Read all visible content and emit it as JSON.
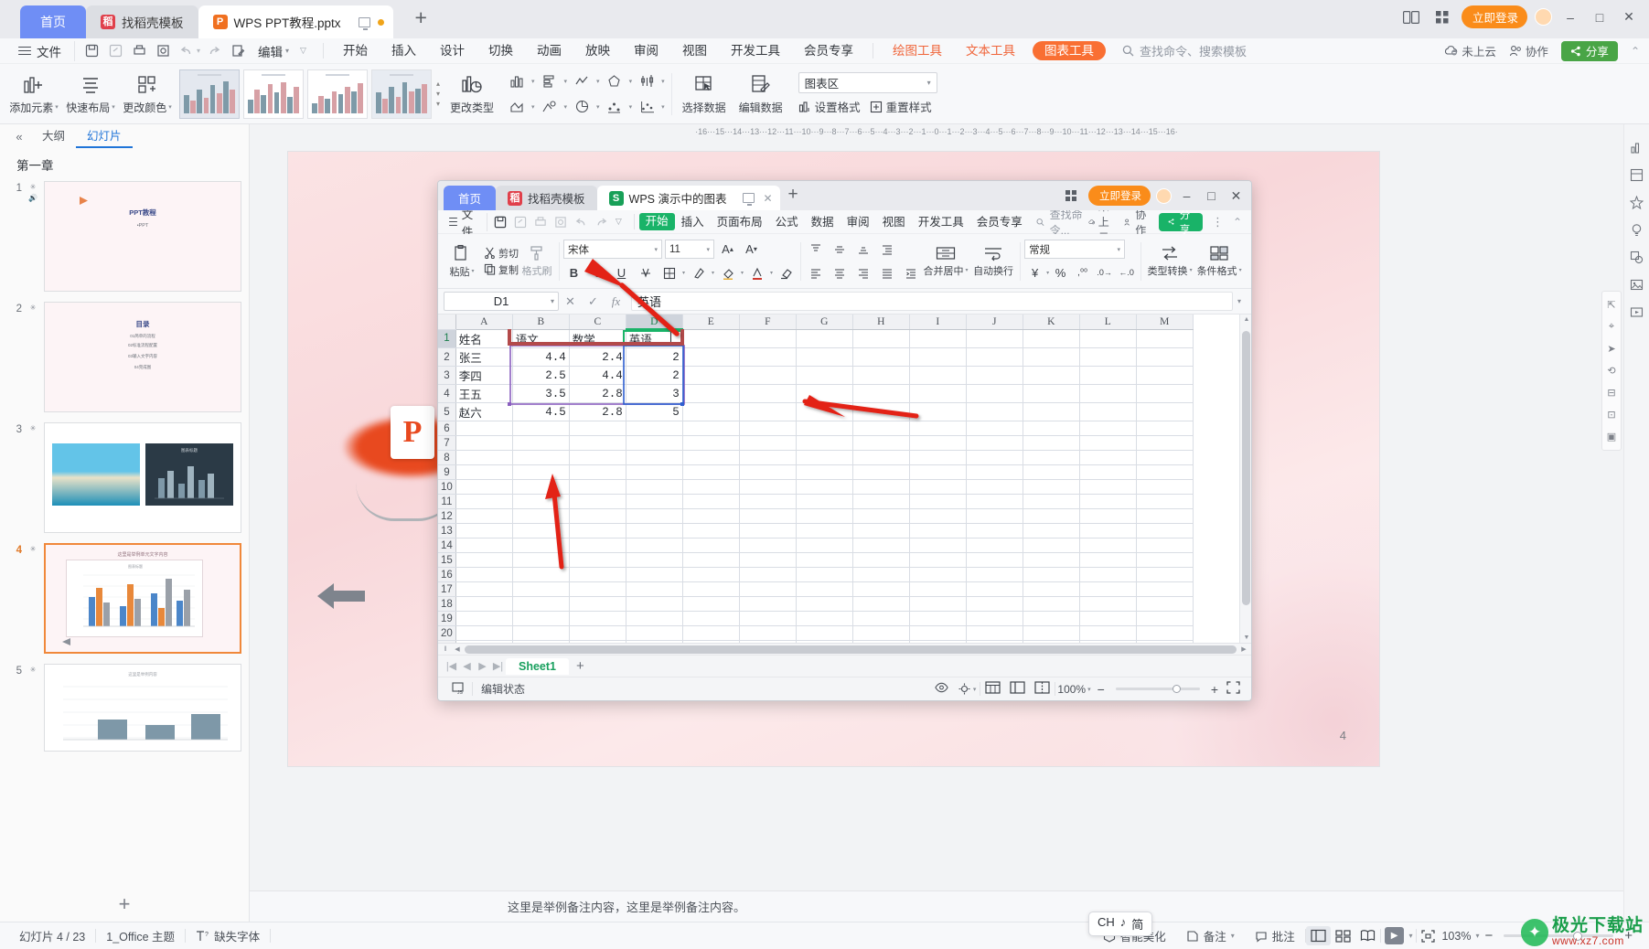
{
  "app": {
    "tabs": [
      {
        "label": "首页",
        "kind": "home"
      },
      {
        "label": "找稻壳模板",
        "kind": "tpl",
        "icon": "daoke-icon"
      },
      {
        "label": "WPS PPT教程.pptx",
        "kind": "doc",
        "icon": "ppt-file-icon"
      }
    ],
    "new_tab": "+",
    "login_label": "立即登录",
    "window_buttons": [
      "minimize",
      "maximize",
      "close"
    ]
  },
  "menubar": {
    "file_label": "文件",
    "quick_access": [
      "save-icon",
      "save-as-icon",
      "print-icon",
      "print-preview-icon",
      "undo-icon",
      "redo-icon",
      "edit-mode-icon"
    ],
    "edit_label": "编辑",
    "items": [
      "开始",
      "插入",
      "设计",
      "切换",
      "动画",
      "放映",
      "审阅",
      "视图",
      "开发工具",
      "会员专享"
    ],
    "context_items": [
      "绘图工具",
      "文本工具"
    ],
    "active_pill": "图表工具",
    "search_placeholder": "查找命令、搜索模板",
    "cloud_label": "未上云",
    "collab_label": "协作",
    "share_label": "分享"
  },
  "ribbon": {
    "buttons": [
      {
        "label": "添加元素",
        "icon": "add-element-icon",
        "dropdown": true
      },
      {
        "label": "快速布局",
        "icon": "quick-layout-icon",
        "dropdown": true
      },
      {
        "label": "更改颜色",
        "icon": "change-color-icon",
        "dropdown": true
      }
    ],
    "gallery_count": 4,
    "gallery_selected_index": 0,
    "change_type_label": "更改类型",
    "select_data_label": "选择数据",
    "edit_data_label": "编辑数据",
    "chart_area_value": "图表区",
    "set_format_label": "设置格式",
    "reset_style_label": "重置样式",
    "chart_type_icons": [
      "column-chart-icon",
      "bar-chart-icon",
      "line-chart-icon",
      "radar-chart-icon",
      "stock-chart-icon",
      "area-chart-icon",
      "scatter-chart-icon",
      "pie-chart-icon",
      "bubble-chart-icon",
      "combo-chart-icon"
    ]
  },
  "left_panel": {
    "collapse_icon": "collapse-panel-icon",
    "tabs": [
      {
        "label": "大纲",
        "active": false
      },
      {
        "label": "幻灯片",
        "active": true
      }
    ],
    "chapter_label": "第一章",
    "slides": [
      {
        "number": "1",
        "title": "PPT教程",
        "subtitle": "•PPT",
        "kind": "title"
      },
      {
        "number": "2",
        "title": "目录",
        "kind": "toc",
        "lines": [
          "01简单的流程",
          "02标准流程配置",
          "03输入文字内容",
          "04完成图"
        ]
      },
      {
        "number": "3",
        "kind": "two-image"
      },
      {
        "number": "4",
        "kind": "chart",
        "active": true,
        "title": "这里是举例单元文字内容"
      },
      {
        "number": "5",
        "kind": "chart2",
        "title": "这里是举例内容"
      }
    ],
    "add_slide_icon": "add-slide-icon"
  },
  "canvas": {
    "ruler_marks": [
      "16",
      "15",
      "14",
      "13",
      "12",
      "11",
      "10",
      "9",
      "8",
      "7",
      "6",
      "5",
      "4",
      "3",
      "2",
      "1",
      "0",
      "1",
      "2",
      "3",
      "4",
      "5",
      "6",
      "7",
      "8",
      "9",
      "10",
      "11",
      "12",
      "13",
      "14",
      "15",
      "16"
    ],
    "slide_page_number": "4",
    "notes_text": "这里是举例备注内容，这里是举例备注内容。",
    "ppt_logo_letter": "P"
  },
  "right_dock": {
    "icons": [
      "chart-tool-icon",
      "layout-icon",
      "effects-icon",
      "design-idea-icon",
      "shape-icon",
      "image-icon",
      "media-icon"
    ],
    "float_icons": [
      "align-icon",
      "select-icon",
      "distribute-icon",
      "rotate-icon",
      "group-icon",
      "crop-icon",
      "frame-icon"
    ]
  },
  "statusbar": {
    "slide_counter": "幻灯片 4 / 23",
    "theme": "1_Office 主题",
    "missing_font": "缺失字体",
    "smart_beauty": "智能美化",
    "notes_label": "备注",
    "comment_label": "批注",
    "view_icons": [
      "normal-view-icon",
      "slide-sorter-icon",
      "reading-view-icon"
    ],
    "play_label": "▶",
    "fit_icon": "fit-to-window-icon",
    "zoom": "103%",
    "zoom_out": "−",
    "zoom_in": "+",
    "ime_tip": [
      "CH",
      "♪",
      "简"
    ]
  },
  "watermark": {
    "line1": "极光下载站",
    "line2": "www.xz7.com"
  },
  "spreadsheet": {
    "tabs": [
      {
        "label": "首页",
        "kind": "home"
      },
      {
        "label": "找稻壳模板",
        "kind": "tpl",
        "icon": "daoke-icon"
      },
      {
        "label": "WPS 演示中的图表",
        "kind": "doc",
        "icon": "et-file-icon"
      }
    ],
    "new_tab": "+",
    "login_label": "立即登录",
    "menubar": {
      "file_label": "文件",
      "quick_access": [
        "save-icon",
        "save-as-icon",
        "print-icon",
        "print-preview-icon",
        "undo-icon",
        "redo-icon"
      ],
      "active_item": "开始",
      "items": [
        "插入",
        "页面布局",
        "公式",
        "数据",
        "审阅",
        "视图",
        "开发工具",
        "会员专享"
      ],
      "search_placeholder": "查找命令...",
      "cloud_label": "未上云",
      "collab_label": "协作",
      "share_label": "分享"
    },
    "ribbon": {
      "paste_label": "粘贴",
      "cut_label": "剪切",
      "copy_label": "复制",
      "format_brush_label": "格式刷",
      "font_name": "宋体",
      "font_size": "11",
      "grow_font_icon": "grow-font-icon",
      "shrink_font_icon": "shrink-font-icon",
      "bold": "B",
      "italic": "I",
      "underline": "U",
      "merge_label": "合并居中",
      "wrap_label": "自动换行",
      "number_format": "常规",
      "type_convert_label": "类型转换",
      "conditional_format_label": "条件格式"
    },
    "formula_bar": {
      "name_box": "D1",
      "cancel_icon": "cancel-icon",
      "confirm_icon": "confirm-icon",
      "fx_icon": "fx-icon",
      "value": "英语"
    },
    "grid": {
      "columns": [
        "A",
        "B",
        "C",
        "D",
        "E",
        "F",
        "G",
        "H",
        "I",
        "J",
        "K",
        "L",
        "M"
      ],
      "selected_column": "D",
      "selected_row": "1",
      "row_count": 22,
      "header_row": [
        "姓名",
        "语文",
        "数学",
        "英语"
      ],
      "rows": [
        {
          "name": "张三",
          "chinese": "4.4",
          "math": "2.4",
          "english": "2"
        },
        {
          "name": "李四",
          "chinese": "2.5",
          "math": "4.4",
          "english": "2"
        },
        {
          "name": "王五",
          "chinese": "3.5",
          "math": "2.8",
          "english": "3"
        },
        {
          "name": "赵六",
          "chinese": "4.5",
          "math": "2.8",
          "english": "5"
        }
      ]
    },
    "sheet_tabs": {
      "nav": [
        "|◀",
        "◀",
        "▶",
        "▶|"
      ],
      "active": "Sheet1",
      "add_icon": "add-sheet-icon"
    },
    "status": {
      "js_icon": "js-console-icon",
      "state": "编辑状态",
      "zoom": "100%",
      "zoom_out": "−",
      "zoom_in": "+",
      "fullscreen_icon": "fullscreen-icon",
      "view_icons": [
        "normal-view-icon",
        "page-layout-icon",
        "page-break-icon"
      ],
      "eye_icon": "eye-icon",
      "cursor_icon": "cursor-mode-icon"
    }
  },
  "colors": {
    "accent_blue": "#6f8ef5",
    "accent_orange": "#fa8c1a",
    "et_green": "#19b368",
    "ppt_orange": "#e8491f",
    "annotation_red": "#e32119",
    "selection_teal": "#19b368"
  }
}
